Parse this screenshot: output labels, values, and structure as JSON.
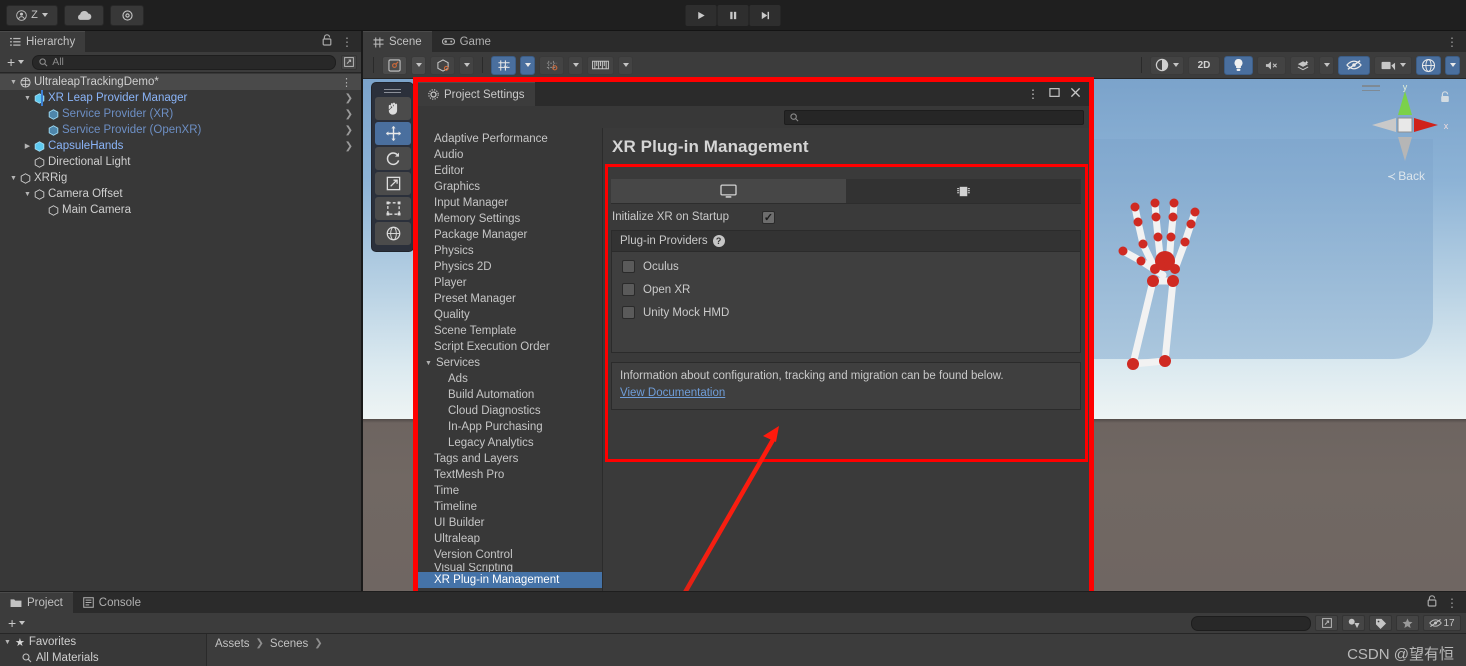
{
  "topbar": {
    "account_label": "Z",
    "icons": [
      "account-icon",
      "cloud-icon",
      "gear-icon"
    ],
    "play": "play-icon",
    "pause": "pause-icon",
    "step": "step-icon"
  },
  "hierarchy": {
    "tab_label": "Hierarchy",
    "tab_icon": "hierarchy-icon",
    "lock_icon": "lock-icon",
    "menu_icon": "kebab-icon",
    "add_label": "+",
    "search_placeholder": "All",
    "items": [
      {
        "label": "UltraleapTrackingDemo*",
        "depth": 1,
        "expanded": true,
        "icon": "scene-icon",
        "style": "normal",
        "kebab": true
      },
      {
        "label": "XR Leap Provider Manager",
        "depth": 2,
        "expanded": true,
        "icon": "prefab-icon",
        "style": "prefab",
        "chevron": true,
        "selected_bar": true
      },
      {
        "label": "Service Provider (XR)",
        "depth": 3,
        "expanded": false,
        "icon": "prefab-icon",
        "style": "prefab-dim",
        "chevron": true
      },
      {
        "label": "Service Provider (OpenXR)",
        "depth": 3,
        "expanded": false,
        "icon": "prefab-icon",
        "style": "prefab-dim",
        "chevron": true
      },
      {
        "label": "CapsuleHands",
        "depth": 2,
        "expanded": false,
        "collapsed_arrow": true,
        "icon": "prefab-variant-icon",
        "style": "prefab",
        "chevron": true
      },
      {
        "label": "Directional Light",
        "depth": 2,
        "icon": "gameobject-icon",
        "style": "normal"
      },
      {
        "label": "XRRig",
        "depth": 1,
        "expanded": true,
        "icon": "gameobject-icon",
        "style": "normal"
      },
      {
        "label": "Camera Offset",
        "depth": 2,
        "expanded": true,
        "icon": "gameobject-icon",
        "style": "normal"
      },
      {
        "label": "Main Camera",
        "depth": 3,
        "icon": "gameobject-icon",
        "style": "normal"
      }
    ]
  },
  "scene": {
    "tabs": [
      {
        "label": "Scene",
        "icon": "scene-grid-icon",
        "active": true
      },
      {
        "label": "Game",
        "icon": "gamepad-icon",
        "active": false
      }
    ],
    "menu_icon": "kebab-icon",
    "left_toolbar": [
      {
        "name": "view-hand-tool",
        "icon": "hand-icon",
        "active": false
      },
      {
        "name": "move-tool",
        "icon": "move-icon",
        "active": true
      },
      {
        "name": "rotate-tool",
        "icon": "rotate-icon",
        "active": false
      },
      {
        "name": "scale-tool",
        "icon": "scale-icon",
        "active": false
      },
      {
        "name": "rect-tool",
        "icon": "rect-icon",
        "active": false
      },
      {
        "name": "transform-tool",
        "icon": "transform-icon",
        "active": false
      }
    ],
    "toolbar_left": [
      {
        "name": "pivot-center-toggle",
        "icon": "pivot-icon",
        "dropdown": true
      },
      {
        "name": "local-global-toggle",
        "icon": "cube-handle-icon",
        "dropdown": true
      },
      {
        "name": "grid-snapping-toggle",
        "icon": "grid-snap-icon",
        "active": true,
        "dropdown": true
      },
      {
        "name": "grid-visibility-toggle",
        "icon": "grid-icon",
        "active": false,
        "dropdown": true
      },
      {
        "name": "grid-size-control",
        "icon": "ruler-icon",
        "dropdown": true
      }
    ],
    "toolbar_right": [
      {
        "name": "draw-mode-dropdown",
        "label": "",
        "icon": "shading-icon",
        "dropdown": true
      },
      {
        "name": "2d-toggle",
        "label": "2D"
      },
      {
        "name": "lighting-toggle",
        "icon": "lightbulb-icon",
        "active": true
      },
      {
        "name": "audio-toggle",
        "icon": "mute-audio-icon"
      },
      {
        "name": "fx-dropdown",
        "icon": "effects-icon",
        "dropdown": true
      },
      {
        "name": "scene-visibility-toggle",
        "icon": "eye-off-icon",
        "active": true
      },
      {
        "name": "camera-dropdown",
        "icon": "camera-icon",
        "dropdown": true
      },
      {
        "name": "gizmos-dropdown",
        "icon": "gizmo-globe-icon",
        "active": true,
        "dropdown": true
      }
    ],
    "gizmo": {
      "axis_x": "x",
      "axis_y": "y",
      "view_label": "Back",
      "lock_icon": "lock-icon"
    }
  },
  "project_settings": {
    "title": "Project Settings",
    "title_icon": "gear-icon",
    "window_buttons": [
      "kebab-icon",
      "maximize-icon",
      "close-icon"
    ],
    "search_placeholder": "",
    "search_icon": "search-icon",
    "categories": [
      {
        "label": "Adaptive Performance",
        "level": 0
      },
      {
        "label": "Audio",
        "level": 0
      },
      {
        "label": "Editor",
        "level": 0
      },
      {
        "label": "Graphics",
        "level": 0
      },
      {
        "label": "Input Manager",
        "level": 0
      },
      {
        "label": "Memory Settings",
        "level": 0
      },
      {
        "label": "Package Manager",
        "level": 0
      },
      {
        "label": "Physics",
        "level": 0
      },
      {
        "label": "Physics 2D",
        "level": 0
      },
      {
        "label": "Player",
        "level": 0
      },
      {
        "label": "Preset Manager",
        "level": 0
      },
      {
        "label": "Quality",
        "level": 0
      },
      {
        "label": "Scene Template",
        "level": 0
      },
      {
        "label": "Script Execution Order",
        "level": 0
      },
      {
        "label": "Services",
        "level": 0,
        "group": true,
        "expanded": true
      },
      {
        "label": "Ads",
        "level": 1
      },
      {
        "label": "Build Automation",
        "level": 1
      },
      {
        "label": "Cloud Diagnostics",
        "level": 1
      },
      {
        "label": "In-App Purchasing",
        "level": 1
      },
      {
        "label": "Legacy Analytics",
        "level": 1
      },
      {
        "label": "Tags and Layers",
        "level": 0
      },
      {
        "label": "TextMesh Pro",
        "level": 0
      },
      {
        "label": "Time",
        "level": 0
      },
      {
        "label": "Timeline",
        "level": 0
      },
      {
        "label": "UI Builder",
        "level": 0
      },
      {
        "label": "Ultraleap",
        "level": 0
      },
      {
        "label": "Version Control",
        "level": 0
      },
      {
        "label": "Visual Scripting",
        "level": 0,
        "clipped": true
      },
      {
        "label": "XR Plug-in Management",
        "level": 0,
        "active": true
      }
    ],
    "page": {
      "heading": "XR Plug-in Management",
      "platform_tabs": [
        {
          "name": "desktop-platform-tab",
          "icon": "monitor-icon",
          "active": true
        },
        {
          "name": "android-platform-tab",
          "icon": "android-chip-icon",
          "active": false
        }
      ],
      "initialize_label": "Initialize XR on Startup",
      "initialize_checked": true,
      "providers_header": "Plug-in Providers",
      "providers_help_icon": "help-icon",
      "providers": [
        {
          "label": "Oculus",
          "checked": false
        },
        {
          "label": "Open XR",
          "checked": false
        },
        {
          "label": "Unity Mock HMD",
          "checked": false
        }
      ],
      "info_text": "Information about configuration, tracking and migration can be found below.",
      "info_link": "View Documentation"
    }
  },
  "bottom_panel": {
    "tabs": [
      {
        "label": "Project",
        "icon": "folder-icon",
        "active": true
      },
      {
        "label": "Console",
        "icon": "console-icon",
        "active": false
      }
    ],
    "lock_icon": "lock-icon",
    "menu_icon": "kebab-icon",
    "add_label": "+",
    "favorites_label": "Favorites",
    "favorites_icon": "star-icon",
    "all_materials_label": "All Materials",
    "all_materials_icon": "search-icon",
    "breadcrumbs": [
      "Assets",
      "Scenes"
    ],
    "right_icons": [
      {
        "name": "expand-search-icon",
        "label": ""
      },
      {
        "name": "filter-type-icon",
        "label": ""
      },
      {
        "name": "filter-label-icon",
        "label": ""
      },
      {
        "name": "favorites-filter-icon",
        "label": ""
      },
      {
        "name": "visibility-count-icon",
        "label": "17"
      }
    ]
  },
  "watermark": "CSDN @望有恒",
  "colors": {
    "accent_red": "#ff0000",
    "selection_blue": "#4573a8",
    "link_blue": "#6f9dd8",
    "panel_bg": "#383838",
    "toolbar_bg": "#3c3c3c",
    "titlebar_bg": "#2b2b2b"
  }
}
